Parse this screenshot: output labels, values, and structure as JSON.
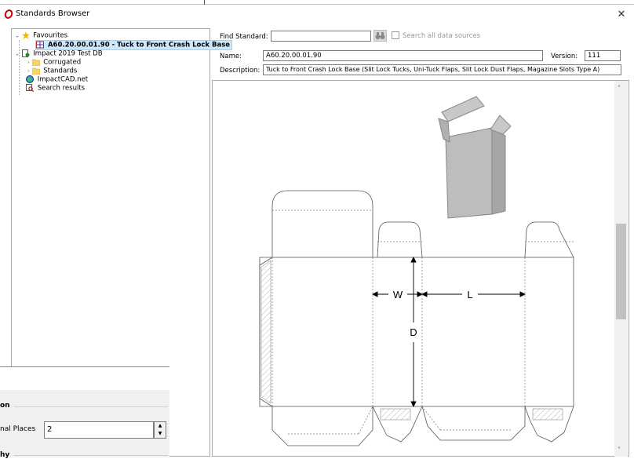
{
  "window": {
    "title": "Standards Browser",
    "close_glyph": "✕",
    "top_line_color": "#000000"
  },
  "tree": {
    "favourites": "Favourites",
    "favourite_item": "A60.20.00.01.90 - Tuck to Front Crash Lock Base",
    "database": "Impact 2019 Test DB",
    "corrugated": "Corrugated",
    "standards": "Standards",
    "impactcad": "ImpactCAD.net",
    "search_results": "Search results"
  },
  "search": {
    "find_label": "Find Standard:",
    "find_value": "",
    "all_sources_label": "Search all data sources",
    "all_sources_checked": false
  },
  "details": {
    "name_label": "Name:",
    "name_value": "A60.20.00.01.90",
    "version_label": "Version:",
    "version_value": "111",
    "description_label": "Description:",
    "description_value": "Tuck to Front Crash Lock Base (Slit Lock Tucks, Uni-Tuck Flaps, Slit Lock Dust Flaps, Magazine Slots Type A)"
  },
  "drawing": {
    "dim_w": "W",
    "dim_l": "L",
    "dim_d": "D",
    "box_color": "#bdbdbd"
  },
  "popup": {
    "section_label": "on",
    "decimal_label": "nal Places",
    "decimal_value": "2",
    "bottom_label": "hy"
  }
}
